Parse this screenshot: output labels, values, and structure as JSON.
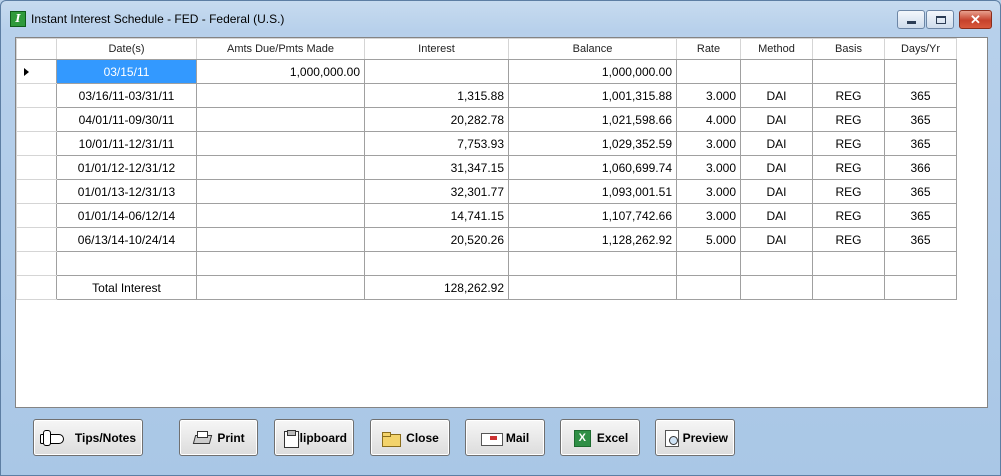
{
  "window": {
    "title": "Instant Interest Schedule - FED - Federal (U.S.)",
    "controls": {
      "minimize": "–",
      "maximize": "□",
      "close": "✕"
    }
  },
  "table": {
    "columns": [
      "Date(s)",
      "Amts Due/Pmts Made",
      "Interest",
      "Balance",
      "Rate",
      "Method",
      "Basis",
      "Days/Yr"
    ],
    "rows": [
      [
        "03/15/11",
        "1,000,000.00",
        "",
        "1,000,000.00",
        "",
        "",
        "",
        ""
      ],
      [
        "03/16/11-03/31/11",
        "",
        "1,315.88",
        "1,001,315.88",
        "3.000",
        "DAI",
        "REG",
        "365"
      ],
      [
        "04/01/11-09/30/11",
        "",
        "20,282.78",
        "1,021,598.66",
        "4.000",
        "DAI",
        "REG",
        "365"
      ],
      [
        "10/01/11-12/31/11",
        "",
        "7,753.93",
        "1,029,352.59",
        "3.000",
        "DAI",
        "REG",
        "365"
      ],
      [
        "01/01/12-12/31/12",
        "",
        "31,347.15",
        "1,060,699.74",
        "3.000",
        "DAI",
        "REG",
        "366"
      ],
      [
        "01/01/13-12/31/13",
        "",
        "32,301.77",
        "1,093,001.51",
        "3.000",
        "DAI",
        "REG",
        "365"
      ],
      [
        "01/01/14-06/12/14",
        "",
        "14,741.15",
        "1,107,742.66",
        "3.000",
        "DAI",
        "REG",
        "365"
      ],
      [
        "06/13/14-10/24/14",
        "",
        "20,520.26",
        "1,128,262.92",
        "5.000",
        "DAI",
        "REG",
        "365"
      ],
      [
        "",
        "",
        "",
        "",
        "",
        "",
        "",
        ""
      ],
      [
        "Total Interest",
        "",
        "128,262.92",
        "",
        "",
        "",
        "",
        ""
      ]
    ],
    "selected_row": 0
  },
  "buttons": {
    "tips": "Tips/Notes",
    "print": "Print",
    "clipboard": "Clipboard",
    "close": "Close",
    "mail": "Mail",
    "excel": "Excel",
    "preview": "Preview"
  },
  "colors": {
    "window_bg": "#b7d0eb",
    "selection": "#3399ff",
    "close_button": "#c6422c"
  }
}
